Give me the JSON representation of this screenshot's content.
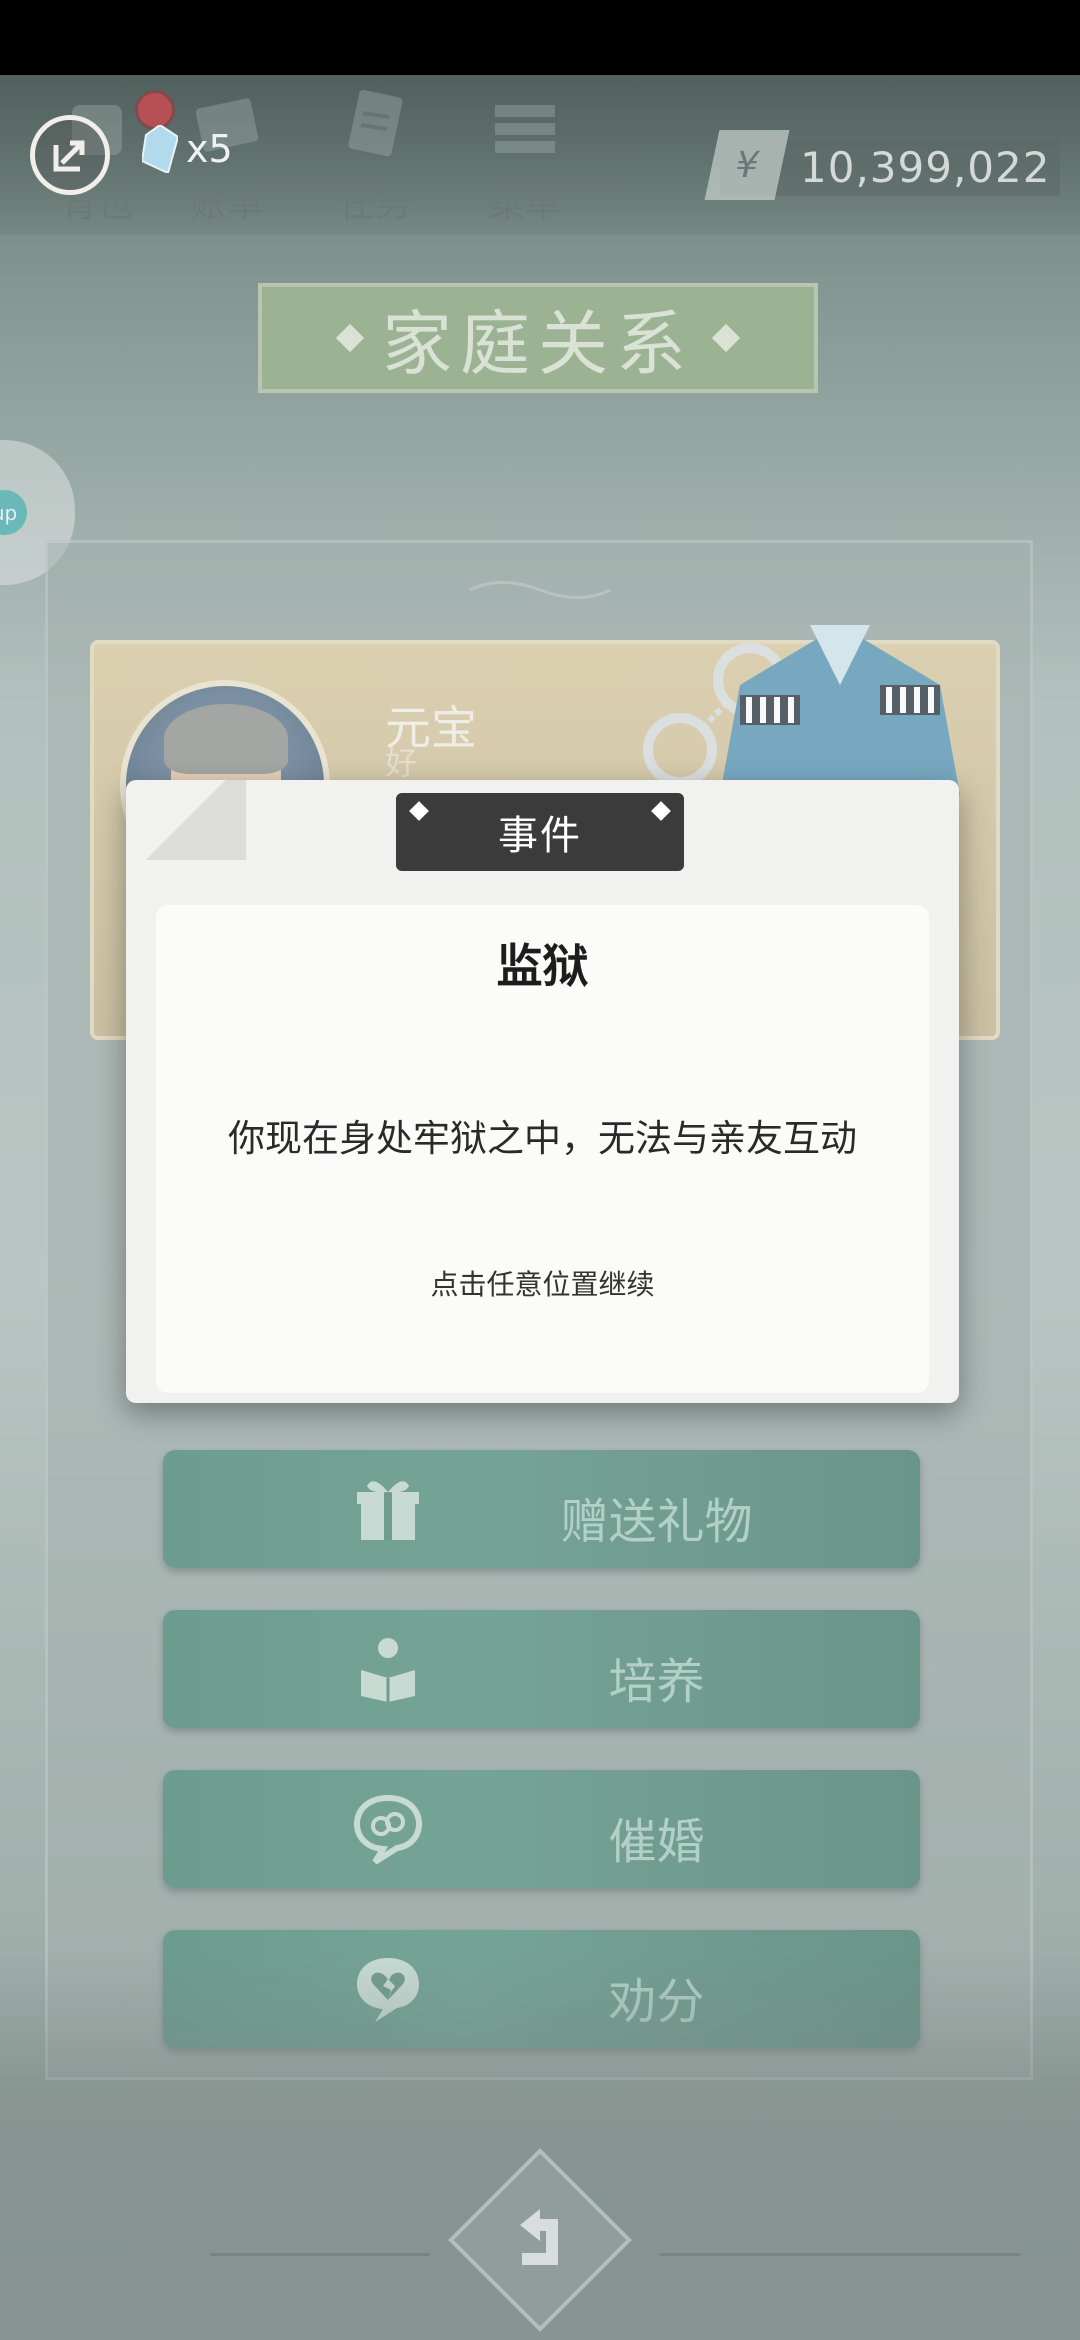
{
  "topbar": {
    "nav": [
      {
        "label": "背包",
        "icon": "backpack-icon"
      },
      {
        "label": "账单",
        "icon": "bill-icon"
      },
      {
        "label": "任务",
        "icon": "task-icon"
      },
      {
        "label": "菜单",
        "icon": "menu-icon"
      }
    ],
    "gem_count": "x5",
    "currency_symbol": "¥",
    "money": "10,399,022"
  },
  "page": {
    "title": "家庭关系"
  },
  "side_bubble": {
    "label": "up"
  },
  "character": {
    "name": "元宝",
    "subtitle": "好"
  },
  "actions": [
    {
      "label": "赠送礼物",
      "icon": "gift-icon"
    },
    {
      "label": "培养",
      "icon": "reading-person-icon"
    },
    {
      "label": "催婚",
      "icon": "marriage-bubble-icon"
    },
    {
      "label": "劝分",
      "icon": "broken-heart-bubble-icon"
    }
  ],
  "modal": {
    "tab": "事件",
    "title": "监狱",
    "message": "你现在身处牢狱之中，无法与亲友互动",
    "hint": "点击任意位置继续"
  },
  "colors": {
    "button_green": "#447e6e",
    "title_plate": "#7f9e72",
    "modal_tab": "#3b3b3b",
    "notify_red": "#a2151b"
  }
}
